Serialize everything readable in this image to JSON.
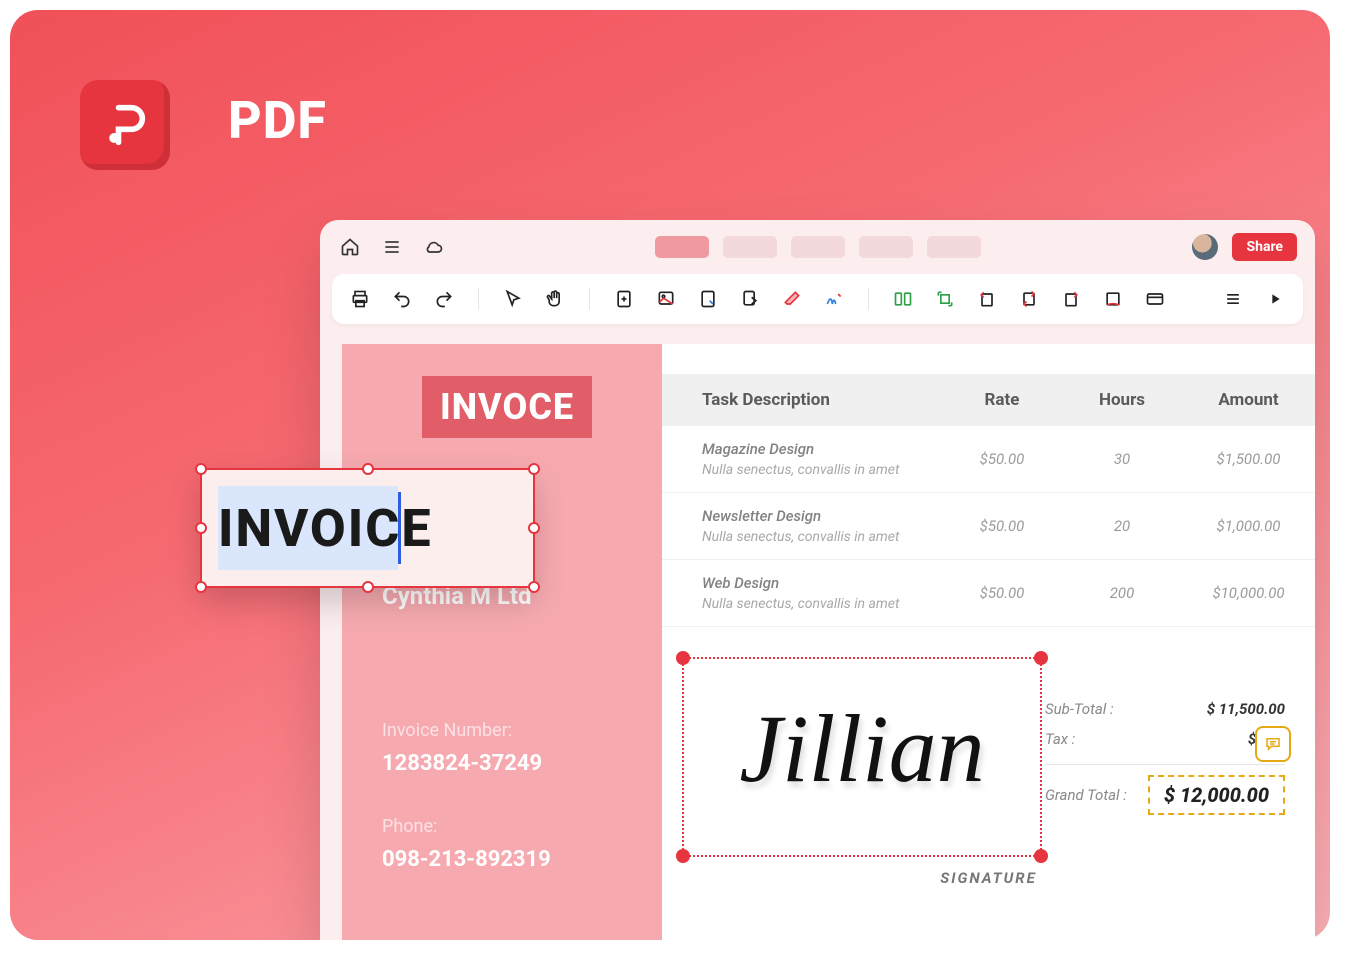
{
  "app": {
    "title": "PDF"
  },
  "titlebar": {
    "share": "Share"
  },
  "toolbar": {},
  "document": {
    "heading_typo": "INVOCE",
    "editing_text": "INVOICE",
    "company": "Cynthia M Ltd",
    "invoice_number_label": "Invoice Number:",
    "invoice_number": "1283824-37249",
    "phone_label": "Phone:",
    "phone": "098-213-892319"
  },
  "table": {
    "headers": {
      "desc": "Task Description",
      "rate": "Rate",
      "hours": "Hours",
      "amount": "Amount"
    },
    "rows": [
      {
        "title": "Magazine Design",
        "sub": "Nulla senectus, convallis in amet",
        "rate": "$50.00",
        "hours": "30",
        "amount": "$1,500.00"
      },
      {
        "title": "Newsletter Design",
        "sub": "Nulla senectus, convallis in amet",
        "rate": "$50.00",
        "hours": "20",
        "amount": "$1,000.00"
      },
      {
        "title": "Web Design",
        "sub": "Nulla senectus, convallis in amet",
        "rate": "$50.00",
        "hours": "200",
        "amount": "$10,000.00"
      }
    ]
  },
  "signature": {
    "name": "Jillian",
    "label": "SIGNATURE"
  },
  "totals": {
    "subtotal_label": "Sub-Total :",
    "subtotal": "$ 11,500.00",
    "tax_label": "Tax :",
    "tax": "$ 500",
    "grand_label": "Grand Total :",
    "grand": "$ 12,000.00"
  }
}
